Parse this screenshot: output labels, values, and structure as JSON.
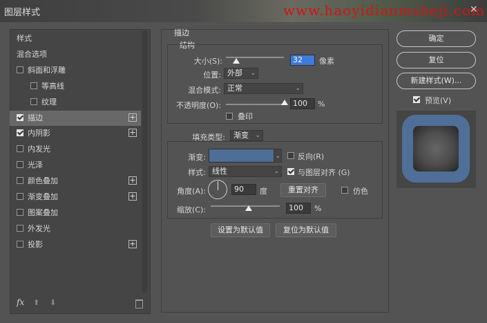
{
  "window": {
    "title": "图层样式",
    "watermark": "www.haoyidianmsheji.com",
    "close": "✕"
  },
  "left_panel": {
    "items": [
      {
        "label": "样式",
        "checkbox": null,
        "plus": false,
        "selected": false
      },
      {
        "label": "混合选项",
        "checkbox": null,
        "plus": false,
        "selected": false
      },
      {
        "label": "斜面和浮雕",
        "checkbox": false,
        "plus": false,
        "selected": false
      },
      {
        "label": "等高线",
        "checkbox": false,
        "plus": false,
        "selected": false
      },
      {
        "label": "纹理",
        "checkbox": false,
        "plus": false,
        "selected": false
      },
      {
        "label": "描边",
        "checkbox": true,
        "plus": true,
        "selected": true
      },
      {
        "label": "内阴影",
        "checkbox": true,
        "plus": true,
        "selected": false
      },
      {
        "label": "内发光",
        "checkbox": false,
        "plus": false,
        "selected": false
      },
      {
        "label": "光泽",
        "checkbox": false,
        "plus": false,
        "selected": false
      },
      {
        "label": "颜色叠加",
        "checkbox": false,
        "plus": true,
        "selected": false
      },
      {
        "label": "渐变叠加",
        "checkbox": false,
        "plus": true,
        "selected": false
      },
      {
        "label": "图案叠加",
        "checkbox": false,
        "plus": false,
        "selected": false
      },
      {
        "label": "外发光",
        "checkbox": false,
        "plus": false,
        "selected": false
      },
      {
        "label": "投影",
        "checkbox": false,
        "plus": true,
        "selected": false
      }
    ],
    "fx_label": "fx",
    "plus_glyph": "+"
  },
  "stroke": {
    "section_title": "描边",
    "structure_title": "结构",
    "size_label": "大小(S):",
    "size_value": "32",
    "size_unit": "像素",
    "size_slider_fraction": 0.18,
    "position_label": "位置:",
    "position_value": "外部",
    "blend_label": "混合模式:",
    "blend_value": "正常",
    "opacity_label": "不透明度(O):",
    "opacity_value": "100",
    "opacity_unit": "%",
    "opacity_slider_fraction": 1.0,
    "overprint_label": "叠印",
    "fill_type_label": "填充类型:",
    "fill_type_value": "渐变",
    "gradient_label": "渐变:",
    "reverse_label": "反向(R)",
    "style_label": "样式:",
    "style_value": "线性",
    "align_label": "与图层对齐 (G)",
    "angle_label": "角度(A):",
    "angle_value": "90",
    "angle_unit": "度",
    "reset_align_label": "重置对齐",
    "dither_label": "仿色",
    "scale_label": "缩放(C):",
    "scale_value": "100",
    "scale_unit": "%",
    "scale_slider_fraction": 0.55,
    "set_default_label": "设置为默认值",
    "reset_default_label": "复位为默认值"
  },
  "right_panel": {
    "ok_label": "确定",
    "reset_label": "复位",
    "new_style_label": "新建样式(W)...",
    "preview_label": "预览(V)"
  },
  "colors": {
    "accent": "#3f7bd9",
    "stroke_gradient": "#4e6e98",
    "watermark": "#d21414"
  }
}
